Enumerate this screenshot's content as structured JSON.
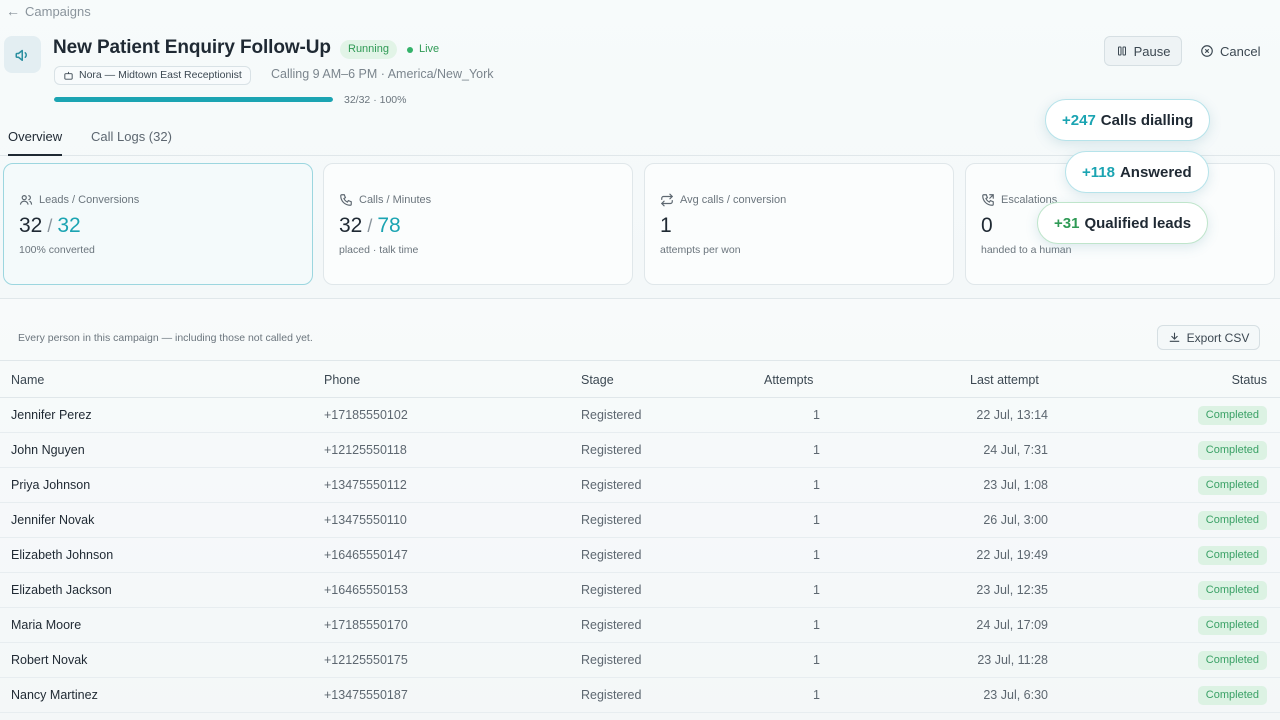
{
  "nav": {
    "back_label": "Campaigns"
  },
  "header": {
    "title": "New Patient Enquiry Follow-Up",
    "status_badge": "Running",
    "live_label": "Live",
    "agent_chip": "Nora — Midtown East Receptionist",
    "schedule": "Calling 9 AM–6 PM · America/New_York",
    "progress_fraction": 1.0,
    "progress_text": "32/32 · 100%",
    "pause_label": "Pause",
    "cancel_label": "Cancel"
  },
  "tabs": [
    {
      "label": "Overview",
      "active": true
    },
    {
      "label": "Call Logs (32)",
      "active": false
    }
  ],
  "stats": [
    {
      "label": "Leads / Conversions",
      "value_a": "32",
      "value_b": "32",
      "sub": "100% converted",
      "icon": "users-icon"
    },
    {
      "label": "Calls / Minutes",
      "value_a": "32",
      "value_b": "78",
      "sub": "placed · talk time",
      "icon": "phone-icon"
    },
    {
      "label": "Avg calls / conversion",
      "value_a": "1",
      "value_b": "",
      "sub": "attempts per won",
      "icon": "repeat-icon"
    },
    {
      "label": "Escalations",
      "value_a": "0",
      "value_b": "",
      "sub": "handed to a human",
      "icon": "phone-forward-icon"
    }
  ],
  "toasts": [
    {
      "num": "+247",
      "label": "Calls dialling"
    },
    {
      "num": "+118",
      "label": "Answered"
    },
    {
      "num": "+31",
      "label": "Qualified leads"
    }
  ],
  "table": {
    "description": "Every person in this campaign — including those not called yet.",
    "export_label": "Export CSV",
    "columns": [
      "Name",
      "Phone",
      "Stage",
      "Attempts",
      "Last attempt",
      "Status"
    ],
    "rows": [
      {
        "name": "Jennifer Perez",
        "phone": "+17185550102",
        "stage": "Registered",
        "attempts": "1",
        "last": "22 Jul, 13:14",
        "status": "Completed"
      },
      {
        "name": "John Nguyen",
        "phone": "+12125550118",
        "stage": "Registered",
        "attempts": "1",
        "last": "24 Jul, 7:31",
        "status": "Completed"
      },
      {
        "name": "Priya Johnson",
        "phone": "+13475550112",
        "stage": "Registered",
        "attempts": "1",
        "last": "23 Jul, 1:08",
        "status": "Completed"
      },
      {
        "name": "Jennifer Novak",
        "phone": "+13475550110",
        "stage": "Registered",
        "attempts": "1",
        "last": "26 Jul, 3:00",
        "status": "Completed"
      },
      {
        "name": "Elizabeth Johnson",
        "phone": "+16465550147",
        "stage": "Registered",
        "attempts": "1",
        "last": "22 Jul, 19:49",
        "status": "Completed"
      },
      {
        "name": "Elizabeth Jackson",
        "phone": "+16465550153",
        "stage": "Registered",
        "attempts": "1",
        "last": "23 Jul, 12:35",
        "status": "Completed"
      },
      {
        "name": "Maria Moore",
        "phone": "+17185550170",
        "stage": "Registered",
        "attempts": "1",
        "last": "24 Jul, 17:09",
        "status": "Completed"
      },
      {
        "name": "Robert Novak",
        "phone": "+12125550175",
        "stage": "Registered",
        "attempts": "1",
        "last": "23 Jul, 11:28",
        "status": "Completed"
      },
      {
        "name": "Nancy Martinez",
        "phone": "+13475550187",
        "stage": "Registered",
        "attempts": "1",
        "last": "23 Jul, 6:30",
        "status": "Completed"
      }
    ]
  },
  "colors": {
    "accent": "#1ba4b2",
    "success": "#2f9a55",
    "success_bg": "#dcf2e3"
  }
}
